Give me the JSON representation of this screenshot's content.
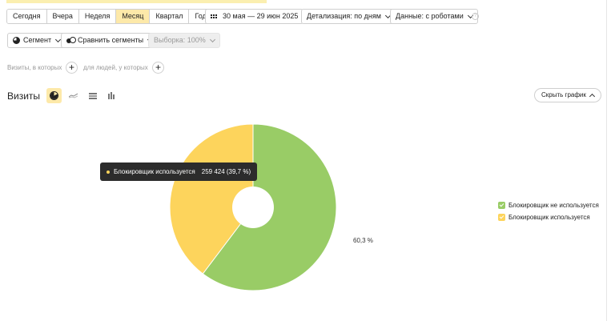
{
  "toolbar": {
    "periods": [
      {
        "label": "Сегодня"
      },
      {
        "label": "Вчера"
      },
      {
        "label": "Неделя"
      },
      {
        "label": "Месяц",
        "active": true
      },
      {
        "label": "Квартал"
      },
      {
        "label": "Год"
      }
    ],
    "date_range": "30 мая — 29 июн 2025",
    "detail": "Детализация: по дням",
    "data_mode": "Данные: с роботами",
    "help_glyph": "?"
  },
  "segments": {
    "segment_label": "Сегмент",
    "compare_label": "Сравнить сегменты",
    "sample_label": "Выборка: 100%"
  },
  "filters": {
    "visits_text": "Визиты, в которых",
    "people_text": "для людей, у которых",
    "plus_glyph": "+"
  },
  "chart_header": {
    "title": "Визиты",
    "hide_label": "Скрыть график"
  },
  "colors": {
    "accent": "#fde9a9",
    "series_not_used": "#99cc66",
    "series_used": "#fdd45c"
  },
  "chart_data": {
    "type": "pie",
    "slices": [
      {
        "name": "Блокировщик не используется",
        "percent": 60.3,
        "color": "#99cc66"
      },
      {
        "name": "Блокировщик используется",
        "percent": 39.7,
        "value": 259424,
        "color": "#fdd45c"
      }
    ],
    "visible_label": "60,3 %",
    "donut": true,
    "legend_position": "right"
  },
  "tooltip": {
    "label": "Блокировщик используется",
    "value": "259 424 (39,7 %)"
  },
  "legend": [
    {
      "label": "Блокировщик не используется",
      "color": "#99cc66"
    },
    {
      "label": "Блокировщик используется",
      "color": "#fdd45c"
    }
  ]
}
